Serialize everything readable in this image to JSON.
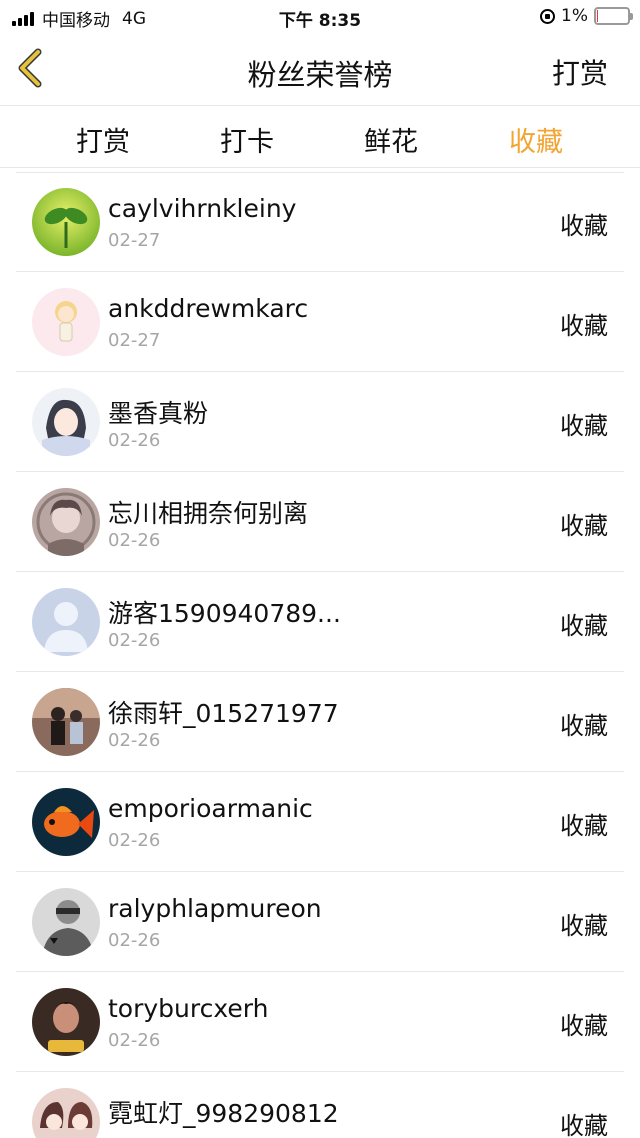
{
  "status_bar": {
    "carrier": "中国移动",
    "network": "4G",
    "time": "下午 8:35",
    "battery": "1%"
  },
  "nav": {
    "title": "粉丝荣誉榜",
    "action_label": "打赏"
  },
  "tabs": [
    {
      "label": "打赏",
      "active": false
    },
    {
      "label": "打卡",
      "active": false
    },
    {
      "label": "鲜花",
      "active": false
    },
    {
      "label": "收藏",
      "active": true
    }
  ],
  "colors": {
    "accent": "#f2a533",
    "back_arrow": "#e8c23b",
    "muted_text": "#a6a6a6"
  },
  "fans": [
    {
      "name": "caylvihrnkleiny",
      "date": "02-27",
      "action": "收藏",
      "avatar": "sprout-avatar"
    },
    {
      "name": "ankddrewmkarc",
      "date": "02-27",
      "action": "收藏",
      "avatar": "cartoon-girl-avatar"
    },
    {
      "name": "墨香真粉",
      "date": "02-26",
      "action": "收藏",
      "avatar": "anime-avatar"
    },
    {
      "name": "忘川相拥奈何别离",
      "date": "02-26",
      "action": "收藏",
      "avatar": "anime-avatar"
    },
    {
      "name": "游客1590940789...",
      "date": "02-26",
      "action": "收藏",
      "avatar": "default-user-avatar"
    },
    {
      "name": "徐雨轩_015271977",
      "date": "02-26",
      "action": "收藏",
      "avatar": "photo-avatar"
    },
    {
      "name": "emporioarmanic",
      "date": "02-26",
      "action": "收藏",
      "avatar": "goldfish-avatar"
    },
    {
      "name": "ralyphlapmureon",
      "date": "02-26",
      "action": "收藏",
      "avatar": "grayscale-photo-avatar"
    },
    {
      "name": "toryburcxerh",
      "date": "02-26",
      "action": "收藏",
      "avatar": "portrait-avatar"
    },
    {
      "name": "霓虹灯_998290812",
      "date": "",
      "action": "收藏",
      "avatar": "anime-avatar"
    }
  ]
}
